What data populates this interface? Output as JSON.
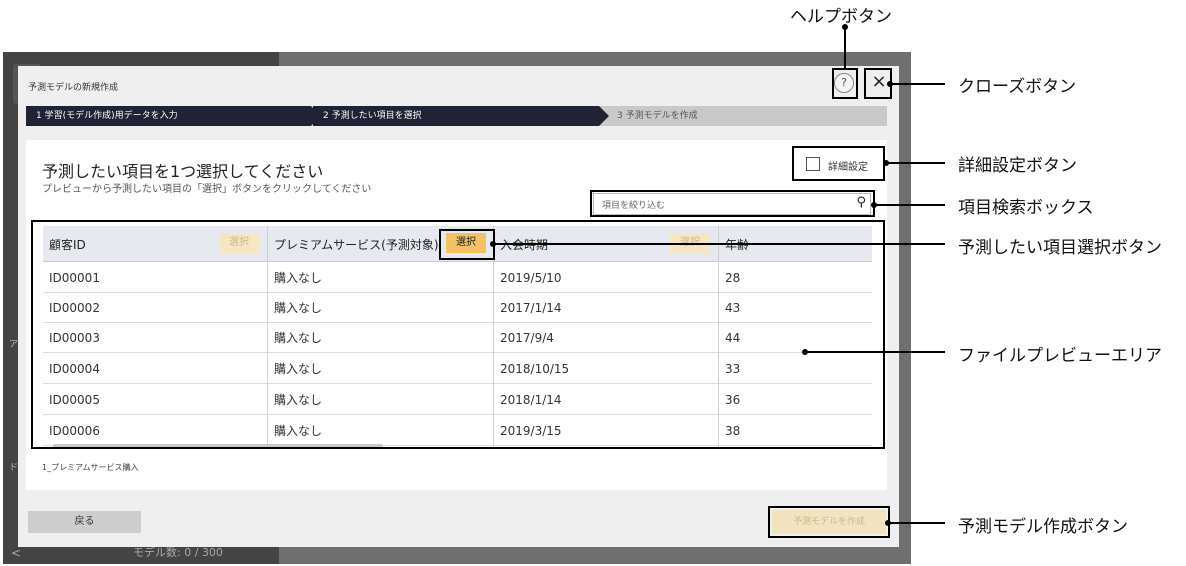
{
  "background": {
    "side_labels": [
      "ア",
      "ド"
    ],
    "model_count": "モデル数: 0 / 300",
    "back_glyph": "<"
  },
  "dialog": {
    "title": "予測モデルの新規作成",
    "help_glyph": "?",
    "close_glyph": "×"
  },
  "steps": [
    {
      "label": "1 学習(モデル作成)用データを入力",
      "state": "done"
    },
    {
      "label": "2 予測したい項目を選択",
      "state": "active"
    },
    {
      "label": "3 予測モデルを作成",
      "state": "pending"
    }
  ],
  "content": {
    "heading": "予測したい項目を1つ選択してください",
    "subheading": "プレビューから予測したい項目の「選択」ボタンをクリックしてください",
    "advanced_label": "詳細設定",
    "search_placeholder": "項目を絞り込む"
  },
  "table": {
    "columns": [
      {
        "label": "顧客ID",
        "select": "選択",
        "selected": false
      },
      {
        "label": "プレミアムサービス(予測対象)",
        "select": "選択",
        "selected": true
      },
      {
        "label": "入会時期",
        "select": "選択",
        "selected": false
      },
      {
        "label": "年齢",
        "select": "",
        "selected": false
      }
    ],
    "rows": [
      [
        "ID00001",
        "購入なし",
        "2019/5/10",
        "28"
      ],
      [
        "ID00002",
        "購入なし",
        "2017/1/14",
        "43"
      ],
      [
        "ID00003",
        "購入なし",
        "2017/9/4",
        "44"
      ],
      [
        "ID00004",
        "購入なし",
        "2018/10/15",
        "33"
      ],
      [
        "ID00005",
        "購入なし",
        "2018/1/14",
        "36"
      ],
      [
        "ID00006",
        "購入なし",
        "2019/3/15",
        "38"
      ]
    ]
  },
  "file_name": "1_プレミアムサービス購入",
  "footer": {
    "back_label": "戻る",
    "create_label": "予測モデルを作成"
  },
  "annotations": {
    "help": "ヘルプボタン",
    "close": "クローズボタン",
    "advanced": "詳細設定ボタン",
    "search": "項目検索ボックス",
    "select": "予測したい項目選択ボタン",
    "preview": "ファイルプレビューエリア",
    "create": "予測モデル作成ボタン"
  }
}
